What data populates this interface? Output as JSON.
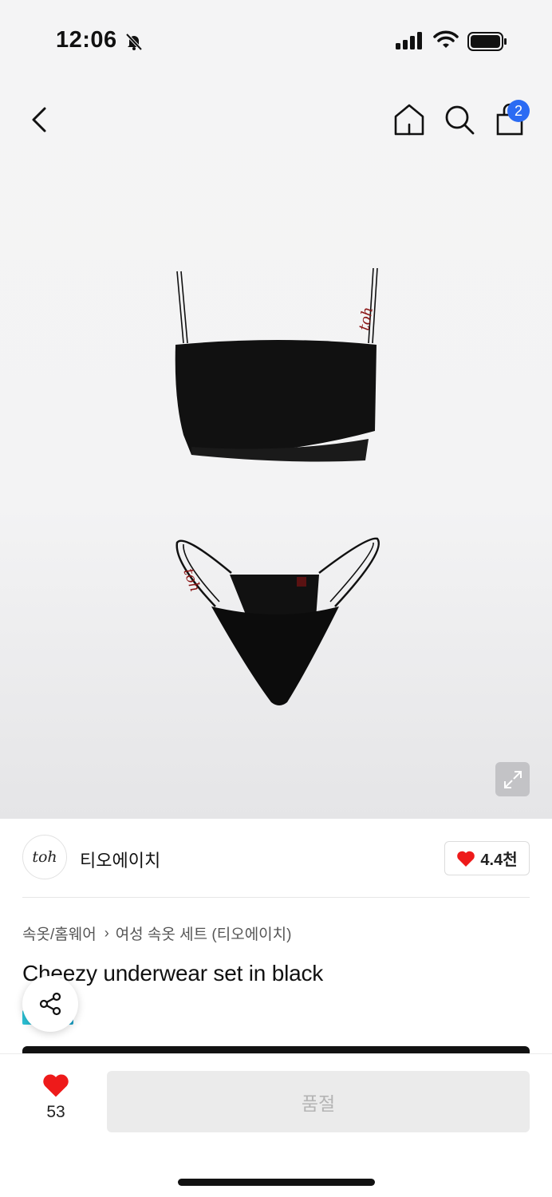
{
  "status_bar": {
    "time": "12:06",
    "icons": [
      "bell-slash-icon",
      "signal-icon",
      "wifi-icon",
      "battery-icon"
    ]
  },
  "nav": {
    "icons": [
      "back-icon",
      "home-icon",
      "search-icon",
      "shopping-bag-icon"
    ],
    "cart_count": "2",
    "badge_color": "#2b6bf3"
  },
  "product_image": {
    "alt": "black bandeau top and string bottom set"
  },
  "brand": {
    "logo_text": "toh",
    "name": "티오에이치",
    "likes": "4.4천"
  },
  "breadcrumb": {
    "items": [
      "속옷/홈웨어",
      "여성 속옷 세트 (티오에이치)"
    ]
  },
  "product": {
    "title": "Cheezy underwear set in black"
  },
  "bottom_bar": {
    "wish_count": "53",
    "soldout_label": "품절"
  },
  "colors": {
    "heart": "#ee1a1a",
    "product": "#111111",
    "accent_red": "#8a1414"
  }
}
